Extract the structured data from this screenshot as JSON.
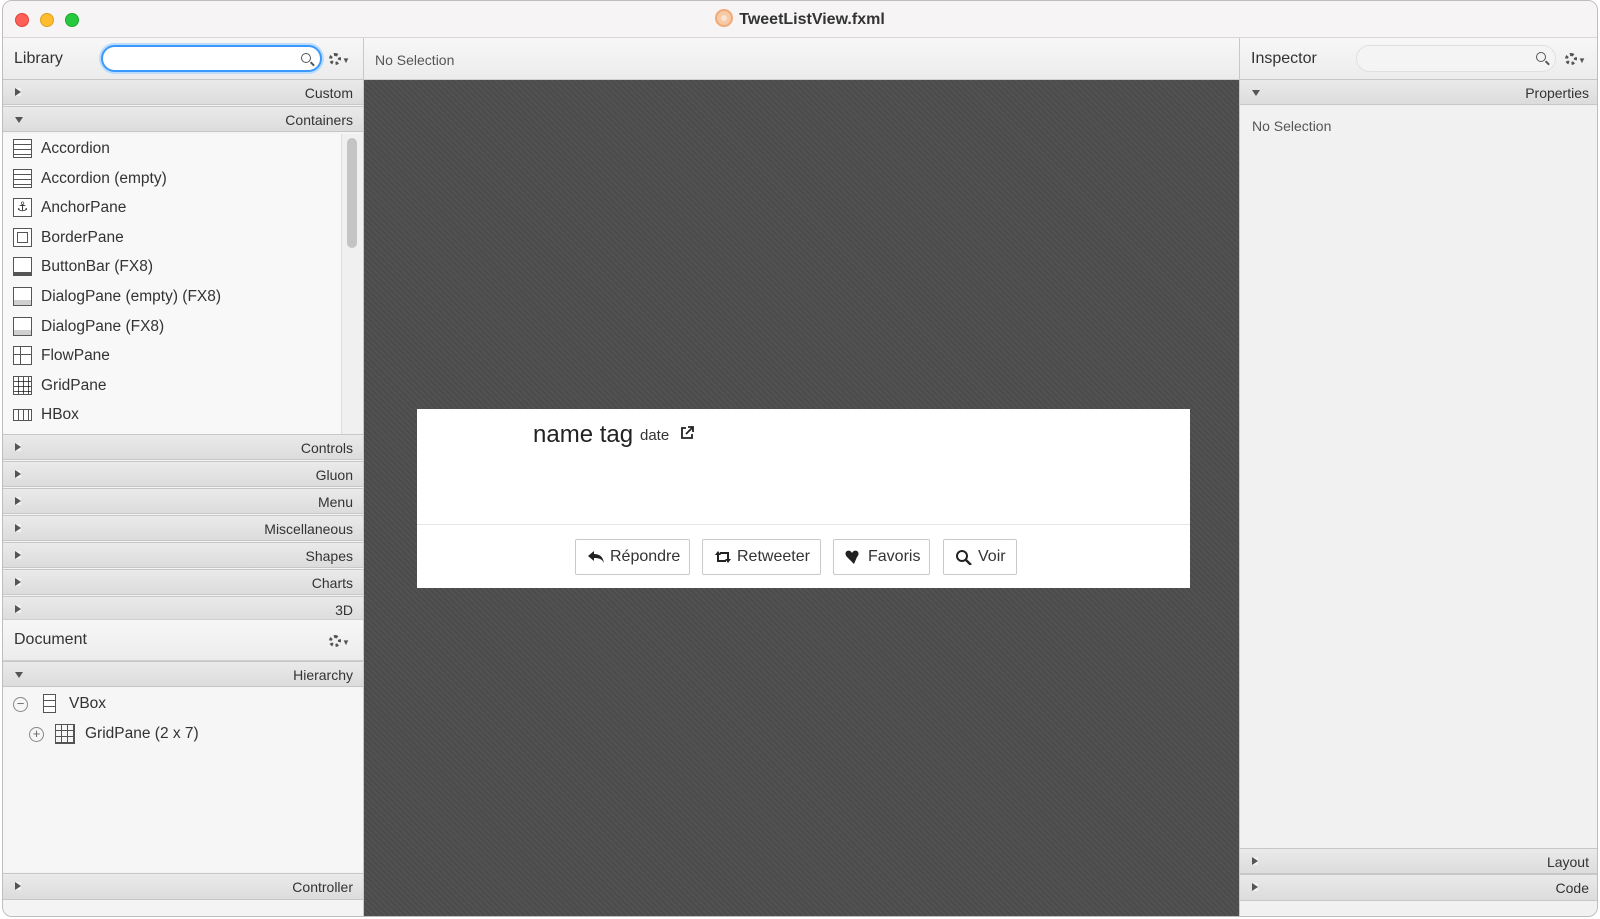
{
  "window": {
    "title": "TweetListView.fxml"
  },
  "library": {
    "title": "Library",
    "search_placeholder": "",
    "sections": {
      "custom": "Custom",
      "containers": "Containers",
      "controls": "Controls",
      "gluon": "Gluon",
      "menu": "Menu",
      "miscellaneous": "Miscellaneous",
      "shapes": "Shapes",
      "charts": "Charts",
      "three_d": "3D"
    },
    "items": [
      {
        "label": "Accordion",
        "icon": "accordion-icon"
      },
      {
        "label": "Accordion  (empty)",
        "icon": "accordion-icon"
      },
      {
        "label": "AnchorPane",
        "icon": "anchor-icon"
      },
      {
        "label": "BorderPane",
        "icon": "borderpane-icon"
      },
      {
        "label": "ButtonBar  (FX8)",
        "icon": "buttonbar-icon"
      },
      {
        "label": "DialogPane (empty)  (FX8)",
        "icon": "dialogpane-icon"
      },
      {
        "label": "DialogPane  (FX8)",
        "icon": "dialogpane-icon"
      },
      {
        "label": "FlowPane",
        "icon": "flowpane-icon"
      },
      {
        "label": "GridPane",
        "icon": "grid-icon"
      },
      {
        "label": "HBox",
        "icon": "hbox-icon"
      }
    ]
  },
  "document": {
    "title": "Document",
    "hierarchy_label": "Hierarchy",
    "controller_label": "Controller",
    "tree": [
      {
        "label": "VBox",
        "expander": "−",
        "icon": "vbox-icon"
      },
      {
        "label": "GridPane (2 x 7)",
        "expander": "+",
        "icon": "grid-icon"
      }
    ]
  },
  "center": {
    "selection_text": "No Selection",
    "preview": {
      "name": "name tag",
      "date": "date",
      "buttons": [
        {
          "label": "Répondre",
          "icon": "reply-icon"
        },
        {
          "label": "Retweeter",
          "icon": "retweet-icon"
        },
        {
          "label": "Favoris",
          "icon": "heart-icon"
        },
        {
          "label": "Voir",
          "icon": "search-icon"
        }
      ]
    }
  },
  "inspector": {
    "title": "Inspector",
    "search_placeholder": "",
    "properties_label": "Properties",
    "no_selection": "No Selection",
    "layout_label": "Layout",
    "code_label": "Code"
  },
  "colors": {
    "accent": "#1a8cff",
    "canvas_bg": "#4b4b4b"
  }
}
